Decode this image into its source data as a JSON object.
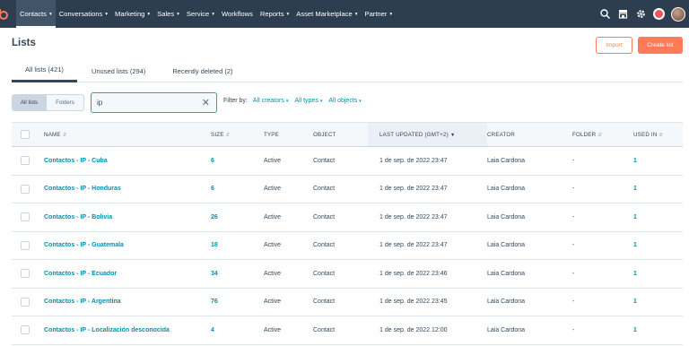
{
  "nav": {
    "logo_icon": "hubspot-sprocket-icon",
    "items": [
      {
        "label": "Contacts",
        "dropdown": true,
        "active": true
      },
      {
        "label": "Conversations",
        "dropdown": true
      },
      {
        "label": "Marketing",
        "dropdown": true
      },
      {
        "label": "Sales",
        "dropdown": true
      },
      {
        "label": "Service",
        "dropdown": true
      },
      {
        "label": "Workflows",
        "dropdown": false
      },
      {
        "label": "Reports",
        "dropdown": true
      },
      {
        "label": "Asset Marketplace",
        "dropdown": true
      },
      {
        "label": "Partner",
        "dropdown": true
      }
    ],
    "icons": [
      "search-icon",
      "marketplace-icon",
      "settings-icon",
      "notifications-icon"
    ],
    "caret": "▾"
  },
  "page": {
    "title": "Lists"
  },
  "actions": {
    "import_label": "Import",
    "create_label": "Create list"
  },
  "tabs": [
    {
      "label": "All lists (421)",
      "active": true
    },
    {
      "label": "Unused lists (294)",
      "active": false
    },
    {
      "label": "Recently deleted (2)",
      "active": false
    }
  ],
  "view_toggle": {
    "all_lists": "All lists",
    "folders": "Folders"
  },
  "search": {
    "value": "ip",
    "placeholder": ""
  },
  "filters": {
    "label": "Filter by:",
    "creators": "All creators",
    "types": "All types",
    "objects": "All objects"
  },
  "table": {
    "columns": {
      "name": "NAME",
      "size": "SIZE",
      "type": "TYPE",
      "object": "OBJECT",
      "last_updated": "LAST UPDATED (GMT+2)",
      "creator": "CREATOR",
      "folder": "FOLDER",
      "used_in": "USED IN"
    },
    "rows": [
      {
        "name": "Contactos - IP - Cuba",
        "size": "6",
        "type": "Active",
        "object": "Contact",
        "last_updated": "1 de sep. de 2022 23:47",
        "creator": "Laia Cardona",
        "folder": "-",
        "used_in": "1"
      },
      {
        "name": "Contactos - IP - Honduras",
        "size": "6",
        "type": "Active",
        "object": "Contact",
        "last_updated": "1 de sep. de 2022 23:47",
        "creator": "Laia Cardona",
        "folder": "-",
        "used_in": "1"
      },
      {
        "name": "Contactos - IP - Bolivia",
        "size": "26",
        "type": "Active",
        "object": "Contact",
        "last_updated": "1 de sep. de 2022 23:47",
        "creator": "Laia Cardona",
        "folder": "-",
        "used_in": "1"
      },
      {
        "name": "Contactos - IP - Guatemala",
        "size": "18",
        "type": "Active",
        "object": "Contact",
        "last_updated": "1 de sep. de 2022 23:47",
        "creator": "Laia Cardona",
        "folder": "-",
        "used_in": "1"
      },
      {
        "name": "Contactos - IP - Ecuador",
        "size": "34",
        "type": "Active",
        "object": "Contact",
        "last_updated": "1 de sep. de 2022 23:46",
        "creator": "Laia Cardona",
        "folder": "-",
        "used_in": "1"
      },
      {
        "name": "Contactos - IP - Argentina",
        "size": "76",
        "type": "Active",
        "object": "Contact",
        "last_updated": "1 de sep. de 2022 23:45",
        "creator": "Laia Cardona",
        "folder": "-",
        "used_in": "1"
      },
      {
        "name": "Contactos - IP - Localización desconocida",
        "size": "4",
        "type": "Active",
        "object": "Contact",
        "last_updated": "1 de sep. de 2022 12:00",
        "creator": "Laia Cardona",
        "folder": "-",
        "used_in": "1"
      }
    ]
  },
  "colors": {
    "nav_bg": "#2d3e50",
    "accent_orange": "#ff7a59",
    "link_teal": "#0091ae",
    "search_border": "#00bda5",
    "text": "#33475b"
  }
}
